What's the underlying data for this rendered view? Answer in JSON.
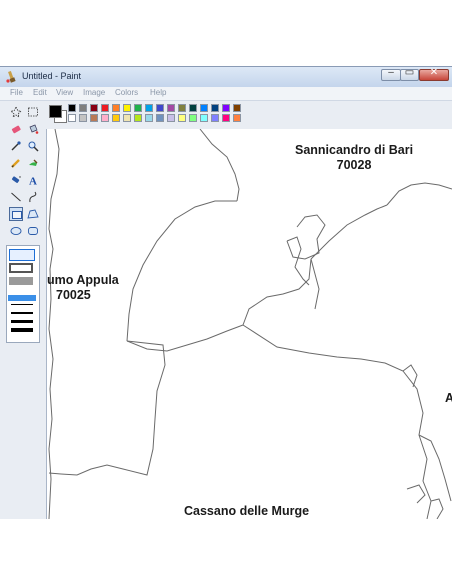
{
  "window": {
    "title": "Untitled - Paint",
    "min_glyph": "–",
    "max_glyph": "▭",
    "close_glyph": "✕"
  },
  "menu": [
    "File",
    "Edit",
    "View",
    "Image",
    "Colors",
    "Help"
  ],
  "tools": [
    {
      "name": "free-form-select-tool",
      "icon": "star-select-icon"
    },
    {
      "name": "rect-select-tool",
      "icon": "rect-select-icon"
    },
    {
      "name": "eraser-tool",
      "icon": "eraser-icon"
    },
    {
      "name": "fill-tool",
      "icon": "fill-bucket-icon"
    },
    {
      "name": "pick-color-tool",
      "icon": "eyedropper-icon"
    },
    {
      "name": "magnifier-tool",
      "icon": "magnifier-icon"
    },
    {
      "name": "pencil-tool",
      "icon": "pencil-icon"
    },
    {
      "name": "brush-tool",
      "icon": "brush-icon"
    },
    {
      "name": "airbrush-tool",
      "icon": "airbrush-icon"
    },
    {
      "name": "text-tool",
      "icon": "text-icon"
    },
    {
      "name": "line-tool",
      "icon": "line-icon"
    },
    {
      "name": "curve-tool",
      "icon": "curve-icon"
    },
    {
      "name": "rectangle-tool",
      "icon": "rectangle-icon"
    },
    {
      "name": "polygon-tool",
      "icon": "polygon-icon"
    },
    {
      "name": "ellipse-tool",
      "icon": "ellipse-icon"
    },
    {
      "name": "rounded-rectangle-tool",
      "icon": "rounded-rect-icon"
    }
  ],
  "selected_tool": "rectangle-tool",
  "colors": {
    "foreground": "#000000",
    "background": "#ffffff",
    "row1": [
      "#000000",
      "#7f7f7f",
      "#880015",
      "#ed1c24",
      "#ff7f27",
      "#fff200",
      "#22b14c",
      "#00a2e8",
      "#3f48cc",
      "#a349a4",
      "#808040",
      "#004040",
      "#0080ff",
      "#004080",
      "#8000ff",
      "#804000"
    ],
    "row2": [
      "#ffffff",
      "#c3c3c3",
      "#b97a57",
      "#ffaec9",
      "#ffc90e",
      "#efe4b0",
      "#b5e61d",
      "#99d9ea",
      "#7092be",
      "#c8bfe7",
      "#ffff80",
      "#80ff80",
      "#80ffff",
      "#8080ff",
      "#ff0080",
      "#ff8040"
    ]
  },
  "map": {
    "labels": {
      "sannicandro_name": "Sannicandro di Bari",
      "sannicandro_cap": "70028",
      "acquaviva_name": "umo Appula",
      "acquaviva_cap": "70025",
      "cassano_name": "Cassano delle Murge",
      "right_edge": "A"
    }
  }
}
